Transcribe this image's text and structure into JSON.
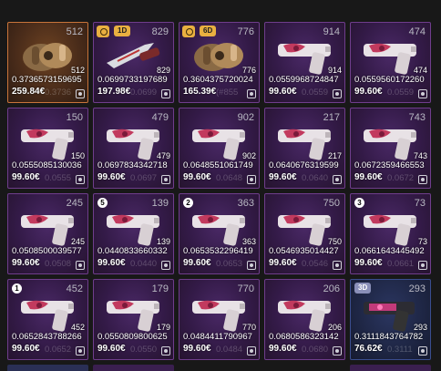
{
  "colors": {
    "background": "#181818",
    "purple_border": "#6f3d8c",
    "orange_border": "#c8743a",
    "badge_gold": "#e9b040"
  },
  "items": [
    {
      "pattern": "512",
      "float": "0.3736573159695",
      "price": "259.84€",
      "ghost": "0.3736",
      "art": "gloves",
      "tier": "orange",
      "badge": "",
      "lock": false,
      "num": ""
    },
    {
      "pattern": "829",
      "float": "0.0699733197689",
      "price": "197.98€",
      "ghost": "0.0699",
      "art": "knife",
      "tier": "purple",
      "badge": "1D",
      "lock": true,
      "num": ""
    },
    {
      "pattern": "776",
      "float": "0.3604375720024",
      "price": "165.39€",
      "ghost": "(#855",
      "art": "gloves",
      "tier": "purple",
      "badge": "6D",
      "lock": true,
      "num": ""
    },
    {
      "pattern": "914",
      "float": "0.0559968724847",
      "price": "99.60€",
      "ghost": "0.0559",
      "art": "pistol",
      "tier": "purple",
      "badge": "",
      "lock": false,
      "num": ""
    },
    {
      "pattern": "474",
      "float": "0.0559560172260",
      "price": "99.60€",
      "ghost": "0.0559",
      "art": "pistol",
      "tier": "purple",
      "badge": "",
      "lock": false,
      "num": ""
    },
    {
      "pattern": "150",
      "float": "0.0555085130036",
      "price": "99.60€",
      "ghost": "0.0555",
      "art": "pistol",
      "tier": "purple",
      "badge": "",
      "lock": false,
      "num": ""
    },
    {
      "pattern": "479",
      "float": "0.0697834342718",
      "price": "99.60€",
      "ghost": "0.0697",
      "art": "pistol",
      "tier": "purple",
      "badge": "",
      "lock": false,
      "num": ""
    },
    {
      "pattern": "902",
      "float": "0.0648551061749",
      "price": "99.60€",
      "ghost": "0.0648",
      "art": "pistol",
      "tier": "purple",
      "badge": "",
      "lock": false,
      "num": ""
    },
    {
      "pattern": "217",
      "float": "0.0640676319599",
      "price": "99.60€",
      "ghost": "0.0640",
      "art": "pistol",
      "tier": "purple",
      "badge": "",
      "lock": false,
      "num": ""
    },
    {
      "pattern": "743",
      "float": "0.0672359466553",
      "price": "99.60€",
      "ghost": "0.0672",
      "art": "pistol",
      "tier": "purple",
      "badge": "",
      "lock": false,
      "num": ""
    },
    {
      "pattern": "245",
      "float": "0.0508500039577",
      "price": "99.60€",
      "ghost": "0.0508",
      "art": "pistol",
      "tier": "purple",
      "badge": "",
      "lock": false,
      "num": ""
    },
    {
      "pattern": "139",
      "float": "0.0440833660332",
      "price": "99.60€",
      "ghost": "0.0440",
      "art": "pistol",
      "tier": "purple",
      "badge": "",
      "lock": false,
      "num": "5"
    },
    {
      "pattern": "363",
      "float": "0.0653532296419",
      "price": "99.60€",
      "ghost": "0.0653",
      "art": "pistol",
      "tier": "purple",
      "badge": "",
      "lock": false,
      "num": "2"
    },
    {
      "pattern": "750",
      "float": "0.0546935014427",
      "price": "99.60€",
      "ghost": "0.0546",
      "art": "pistol",
      "tier": "purple",
      "badge": "",
      "lock": false,
      "num": ""
    },
    {
      "pattern": "73",
      "float": "0.0661643445492",
      "price": "99.60€",
      "ghost": "0.0661",
      "art": "pistol",
      "tier": "purple",
      "badge": "",
      "lock": false,
      "num": "3"
    },
    {
      "pattern": "452",
      "float": "0.0652843788266",
      "price": "99.60€",
      "ghost": "0.0652",
      "art": "pistol",
      "tier": "purple",
      "badge": "",
      "lock": false,
      "num": "1"
    },
    {
      "pattern": "179",
      "float": "0.0550809800625",
      "price": "99.60€",
      "ghost": "0.0550",
      "art": "pistol",
      "tier": "purple",
      "badge": "",
      "lock": false,
      "num": ""
    },
    {
      "pattern": "770",
      "float": "0.0484411790967",
      "price": "99.60€",
      "ghost": "0.0484",
      "art": "pistol",
      "tier": "purple",
      "badge": "",
      "lock": false,
      "num": ""
    },
    {
      "pattern": "206",
      "float": "0.0680586323142",
      "price": "99.60€",
      "ghost": "0.0680",
      "art": "pistol",
      "tier": "purple",
      "badge": "",
      "lock": false,
      "num": ""
    },
    {
      "pattern": "293",
      "float": "0.3111843764782",
      "price": "76.62€",
      "ghost": "0.3111",
      "art": "pistol-dark",
      "tier": "blue",
      "badge": "3D",
      "lock": false,
      "num": ""
    }
  ]
}
